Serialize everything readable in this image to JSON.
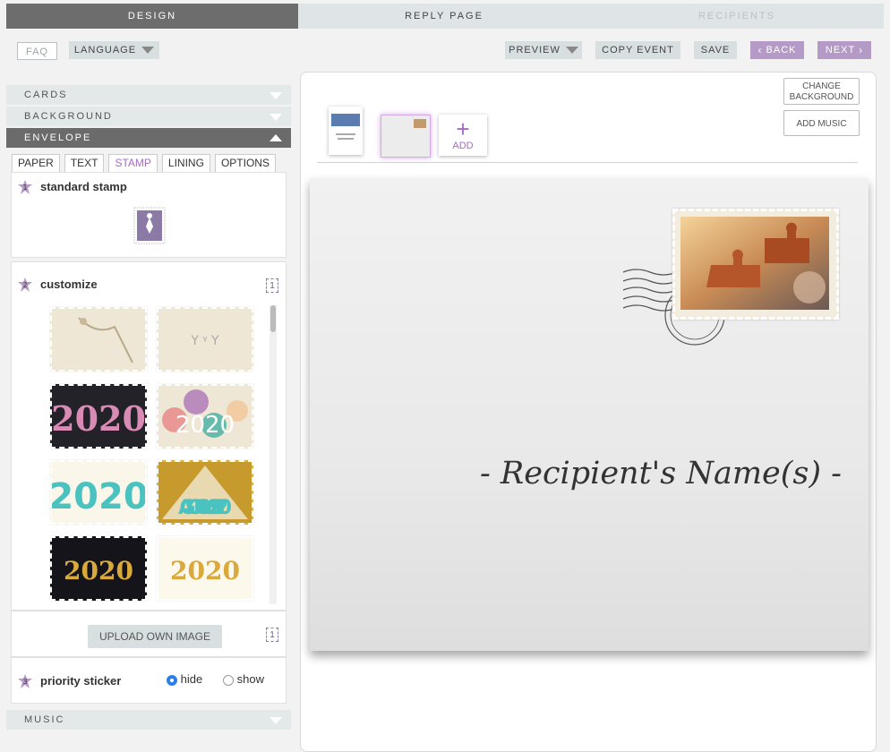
{
  "topbar": {
    "tabs": [
      {
        "label": "DESIGN"
      },
      {
        "label": "REPLY PAGE"
      },
      {
        "label": "RECIPIENTS"
      }
    ]
  },
  "header": {
    "faq": "FAQ",
    "language": "LANGUAGE",
    "preview": "PREVIEW",
    "copy_event": "COPY EVENT",
    "save": "SAVE",
    "back": "BACK",
    "next": "NEXT"
  },
  "sidebar": {
    "sections": [
      "CARDS",
      "BACKGROUND",
      "ENVELOPE",
      "MUSIC"
    ],
    "subtabs": [
      "PAPER",
      "TEXT",
      "STAMP",
      "LINING",
      "OPTIONS"
    ],
    "active_subtab": "STAMP",
    "standard_stamp": {
      "step": "1",
      "title": "standard stamp"
    },
    "customize": {
      "step": "2",
      "title": "customize",
      "count": "1"
    },
    "stamps": [
      {
        "label": ""
      },
      {
        "label": ""
      },
      {
        "label": "2020"
      },
      {
        "label": "2020"
      },
      {
        "label": "2020"
      },
      {
        "label": "A GLORIOUS 2020"
      },
      {
        "label": "2020"
      },
      {
        "label": "2020"
      }
    ],
    "upload": {
      "label": "UPLOAD OWN IMAGE",
      "count": "1"
    },
    "priority_sticker": {
      "step": "3",
      "title": "priority sticker",
      "options": [
        "hide",
        "show"
      ],
      "selected": "hide"
    }
  },
  "canvas": {
    "change_background": "CHANGE BACKGROUND",
    "add_music": "ADD MUSIC",
    "add_label": "ADD",
    "recipient_name": "- Recipient's Name(s) -"
  },
  "colors": {
    "accent": "#b59ac8",
    "active_tab_text": "#a56cc1",
    "design_tab": "#6d6d6d"
  }
}
